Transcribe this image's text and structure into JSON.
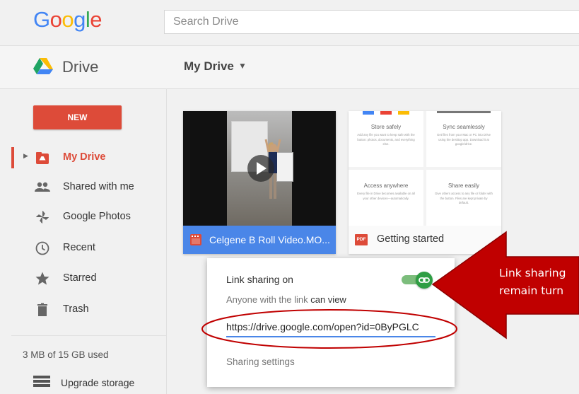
{
  "header": {
    "logo_letters": [
      {
        "ch": "G",
        "color": "#4285f4"
      },
      {
        "ch": "o",
        "color": "#ea4335"
      },
      {
        "ch": "o",
        "color": "#fbbc05"
      },
      {
        "ch": "g",
        "color": "#4285f4"
      },
      {
        "ch": "l",
        "color": "#34a853"
      },
      {
        "ch": "e",
        "color": "#ea4335"
      }
    ],
    "search_placeholder": "Search Drive"
  },
  "subheader": {
    "app_name": "Drive",
    "location_title": "My Drive",
    "location_caret": "▼"
  },
  "sidebar": {
    "new_button": "NEW",
    "items": [
      {
        "label": "My Drive",
        "icon": "my-drive-icon",
        "active": true
      },
      {
        "label": "Shared with me",
        "icon": "people-icon"
      },
      {
        "label": "Google Photos",
        "icon": "pinwheel-icon"
      },
      {
        "label": "Recent",
        "icon": "clock-icon"
      },
      {
        "label": "Starred",
        "icon": "star-icon"
      },
      {
        "label": "Trash",
        "icon": "trash-icon"
      }
    ],
    "storage_used": "3 MB of 15 GB used",
    "upgrade_label": "Upgrade storage"
  },
  "files": {
    "video": {
      "name": "Celgene B Roll Video.MO...",
      "icon": "video-file-icon"
    },
    "getting_started": {
      "name": "Getting started",
      "icon": "pdf-icon",
      "icon_text": "PDF",
      "tiles": [
        {
          "title": "Store safely",
          "body": "Add any file you want to keep safe with the button: photos, documents, and everything else."
        },
        {
          "title": "Sync seamlessly",
          "body": "Get files from your Mac or PC into Drive using the desktop app. Download it at google/drive."
        },
        {
          "title": "Access anywhere",
          "body": "Every file in Drive becomes available on all your other devices—automatically."
        },
        {
          "title": "Share easily",
          "body": "Give others access to any file or folder with the button. Files are kept private by default."
        }
      ]
    }
  },
  "share_popup": {
    "status": "Link sharing on",
    "toggle_on": true,
    "desc_prefix": "Anyone with the link ",
    "desc_permission": "can view",
    "link": "https://drive.google.com/open?id=0ByPGLC",
    "settings_link": "Sharing settings"
  },
  "annotation": {
    "lines": [
      "Link sharing",
      "remain turn"
    ],
    "color": "#c00000"
  },
  "colors": {
    "accent_red": "#dd4b39",
    "accent_blue": "#4a86e8",
    "toggle_green": "#2f9e44"
  }
}
